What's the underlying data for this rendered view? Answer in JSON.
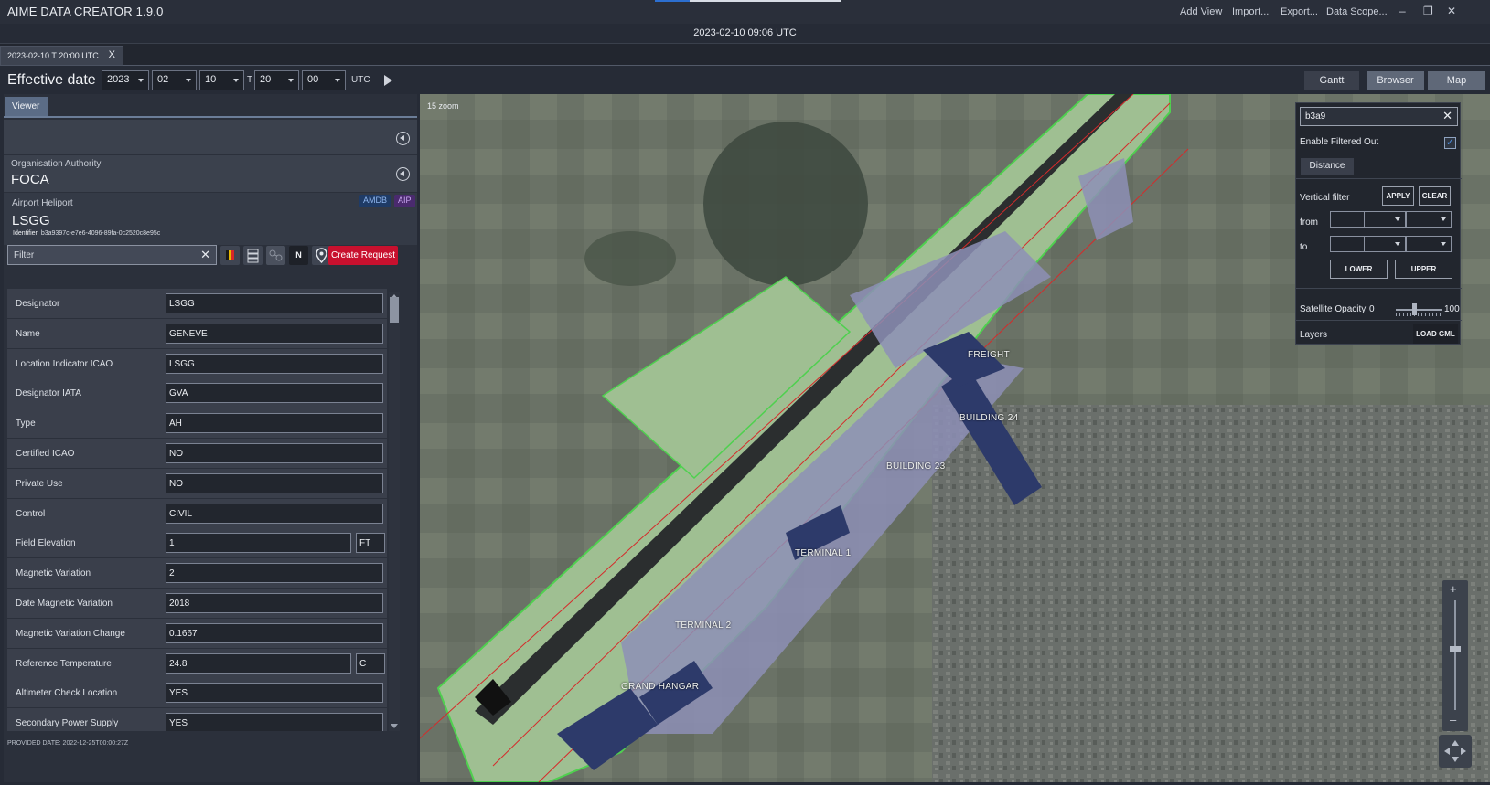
{
  "app": {
    "title": "AIME DATA CREATOR 1.9.0",
    "menu": {
      "add_view": "Add View",
      "import": "Import...",
      "export": "Export...",
      "data_scope": "Data Scope..."
    },
    "window_controls": {
      "minimize": "–",
      "restore": "❐",
      "close": "✕"
    }
  },
  "current_datetime": "2023-02-10 09:06 UTC",
  "document_tab": {
    "label": "2023-02-10 T 20:00 UTC",
    "close": "X"
  },
  "effective_date": {
    "label": "Effective date",
    "year": "2023",
    "month": "02",
    "day": "10",
    "separator": "T",
    "hour": "20",
    "minute": "00",
    "timezone": "UTC"
  },
  "view_buttons": {
    "gantt": "Gantt",
    "browser": "Browser",
    "map": "Map"
  },
  "viewer": {
    "tab": "Viewer",
    "org_label": "Organisation Authority",
    "org_value": "FOCA",
    "airport_label": "Airport Heliport",
    "airport_value": "LSGG",
    "badges": {
      "amdb": "AMDB",
      "aip": "AIP"
    },
    "identifier_label": "Identifier",
    "identifier_value": "b3a9397c-e7e6-4096-89fa-0c2520c8e95c",
    "filter_placeholder": "Filter",
    "filter_clear": "✕",
    "north_button": "N",
    "create_request": "Create Request",
    "provided_date": "PROVIDED DATE: 2022-12-25T00:00:27Z",
    "properties": [
      {
        "label": "Designator",
        "value": "LSGG"
      },
      {
        "label": "Name",
        "value": "GENEVE"
      },
      {
        "label": "Location Indicator ICAO",
        "value": "LSGG"
      },
      {
        "label": "Designator IATA",
        "value": "GVA"
      },
      {
        "label": "Type",
        "value": "AH"
      },
      {
        "label": "Certified ICAO",
        "value": "NO"
      },
      {
        "label": "Private Use",
        "value": "NO"
      },
      {
        "label": "Control",
        "value": "CIVIL"
      },
      {
        "label": "Field Elevation",
        "value": "1",
        "unit": "FT"
      },
      {
        "label": "Magnetic Variation",
        "value": "2"
      },
      {
        "label": "Date Magnetic Variation",
        "value": "2018"
      },
      {
        "label": "Magnetic Variation Change",
        "value": "0.1667"
      },
      {
        "label": "Reference Temperature",
        "value": "24.8",
        "unit": "C"
      },
      {
        "label": "Altimeter Check Location",
        "value": "YES"
      },
      {
        "label": "Secondary Power Supply",
        "value": "YES"
      }
    ]
  },
  "map": {
    "zoom_label": "15 zoom",
    "labels": {
      "freight": "FREIGHT",
      "building24": "BUILDING 24",
      "building23": "BUILDING 23",
      "terminal1": "TERMINAL 1",
      "terminal2": "TERMINAL 2",
      "grand_hangar": "GRAND HANGAR"
    },
    "panel": {
      "search_value": "b3a9",
      "search_clear": "✕",
      "enable_filtered_out": "Enable Filtered Out",
      "enable_filtered_out_checked": true,
      "check_mark": "✓",
      "distance": "Distance",
      "vertical_filter": "Vertical filter",
      "apply": "APPLY",
      "clear": "CLEAR",
      "from": "from",
      "to": "to",
      "lower": "LOWER",
      "upper": "UPPER",
      "satellite_opacity": "Satellite Opacity",
      "opacity_min": "0",
      "opacity_max": "100",
      "opacity_value_fraction": 0.4,
      "layers": "Layers",
      "load_gml": "LOAD GML"
    },
    "nav": {
      "zoom_in": "+",
      "zoom_out": "–"
    }
  }
}
